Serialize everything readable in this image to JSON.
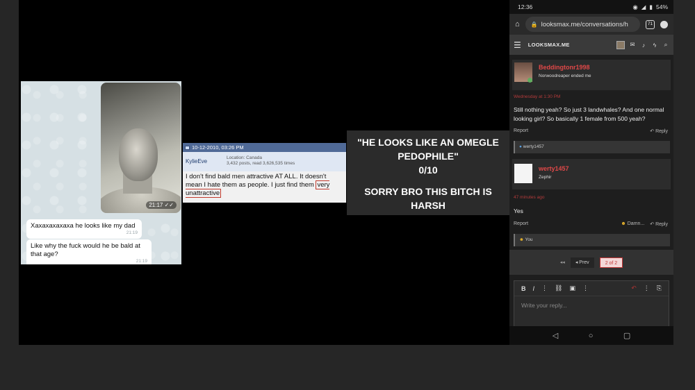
{
  "chat": {
    "photo_time": "21:17 ✓✓",
    "messages": [
      {
        "text": "Xaxaxaxaxaxa he looks like my dad",
        "time": "21:19"
      },
      {
        "text": "Like why the fuck would he be bald at that age?",
        "time": "21:19"
      }
    ]
  },
  "post": {
    "date": "10-12-2010, 03:26 PM",
    "username": "KylieEve",
    "location": "Location: Canada",
    "stats": "3,432 posts, read 3,626,535 times",
    "body_before": "I don't find bald men attractive AT ALL. It doesn't mean I hate them as people. I just find them ",
    "body_highlight": "very unattractive"
  },
  "caption": {
    "line1": "\"HE LOOKS LIKE AN OMEGLE PEDOPHILE\"",
    "line2": "0/10",
    "line3": "SORRY BRO THIS BITCH IS HARSH"
  },
  "phone": {
    "status": {
      "time": "12:36",
      "battery": "54%"
    },
    "url": "looksmax.me/conversations/h",
    "tab_count": "71",
    "site_logo": "LOOKSMAX.ME",
    "message1": {
      "username": "Beddingtonr1998",
      "user_title": "Norwoodreaper ended me",
      "timestamp": "Wednesday at 1:30 PM",
      "text": "Still nothing yeah? So just 3 landwhales? And one normal looking girl? So basically 1 female from 500 yeah?",
      "report": "Report",
      "reply": "Reply",
      "quote_user": "werty1457"
    },
    "message2": {
      "username": "werty1457",
      "user_title": "Zephir",
      "timestamp": "47 minutes ago",
      "text": "Yes",
      "report": "Report",
      "reaction": "Damn...",
      "reply": "Reply",
      "reaction_user": "You"
    },
    "pager": {
      "prev": "Prev",
      "current": "2 of 2"
    },
    "editor": {
      "placeholder": "Write your reply..."
    }
  }
}
